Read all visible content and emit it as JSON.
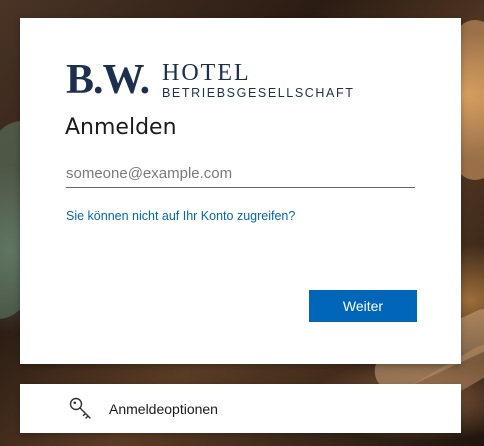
{
  "logo": {
    "mark": "B.W.",
    "name": "HOTEL",
    "subtitle": "BETRIEBSGESELLSCHAFT"
  },
  "signin": {
    "title": "Anmelden",
    "email_placeholder": "someone@example.com",
    "email_value": "",
    "cant_access_link": "Sie können nicht auf Ihr Konto zugreifen?",
    "next_button": "Weiter"
  },
  "options": {
    "icon": "key-icon",
    "label": "Anmeldeoptionen"
  },
  "colors": {
    "accent": "#0067b8",
    "brand": "#1c2f4e"
  }
}
